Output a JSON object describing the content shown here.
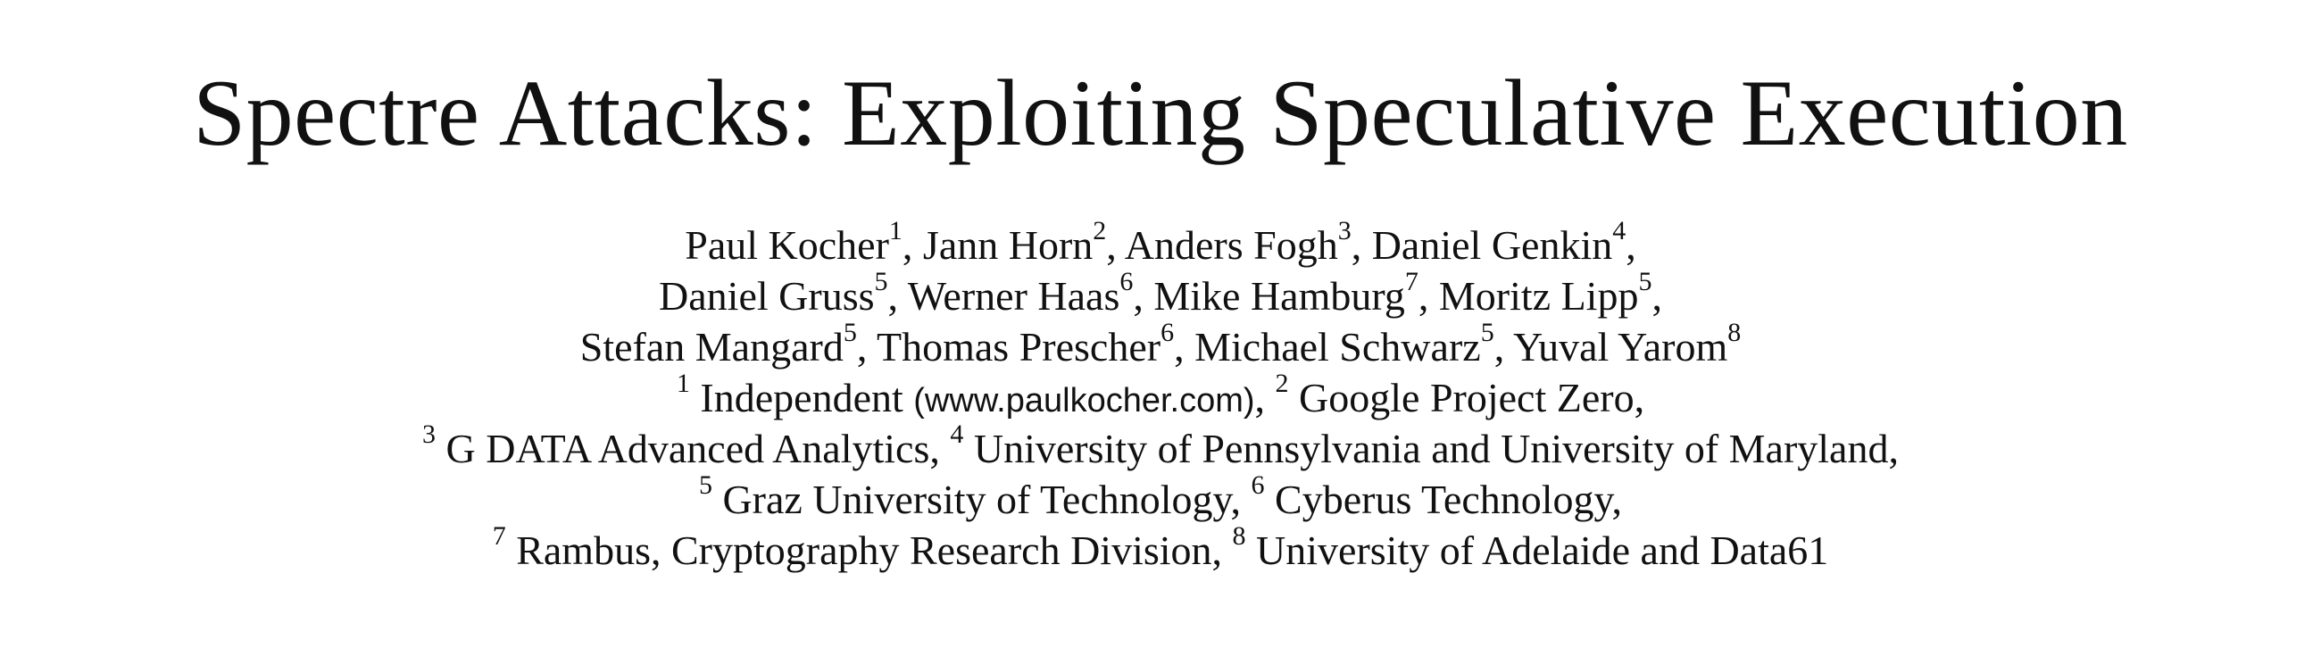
{
  "title": "Spectre Attacks: Exploiting Speculative Execution",
  "authors": [
    {
      "name": "Paul Kocher",
      "aff": "1"
    },
    {
      "name": "Jann Horn",
      "aff": "2"
    },
    {
      "name": "Anders Fogh",
      "aff": "3"
    },
    {
      "name": "Daniel Genkin",
      "aff": "4"
    },
    {
      "name": "Daniel Gruss",
      "aff": "5"
    },
    {
      "name": "Werner Haas",
      "aff": "6"
    },
    {
      "name": "Mike Hamburg",
      "aff": "7"
    },
    {
      "name": "Moritz Lipp",
      "aff": "5"
    },
    {
      "name": "Stefan Mangard",
      "aff": "5"
    },
    {
      "name": "Thomas Prescher",
      "aff": "6"
    },
    {
      "name": "Michael Schwarz",
      "aff": "5"
    },
    {
      "name": "Yuval Yarom",
      "aff": "8"
    }
  ],
  "affiliations": [
    {
      "num": "1",
      "name": "Independent",
      "extra": "(www.paulkocher.com)"
    },
    {
      "num": "2",
      "name": "Google Project Zero"
    },
    {
      "num": "3",
      "name": "G DATA Advanced Analytics"
    },
    {
      "num": "4",
      "name": "University of Pennsylvania and University of Maryland"
    },
    {
      "num": "5",
      "name": "Graz University of Technology"
    },
    {
      "num": "6",
      "name": "Cyberus Technology"
    },
    {
      "num": "7",
      "name": "Rambus, Cryptography Research Division"
    },
    {
      "num": "8",
      "name": "University of Adelaide and Data61"
    }
  ]
}
